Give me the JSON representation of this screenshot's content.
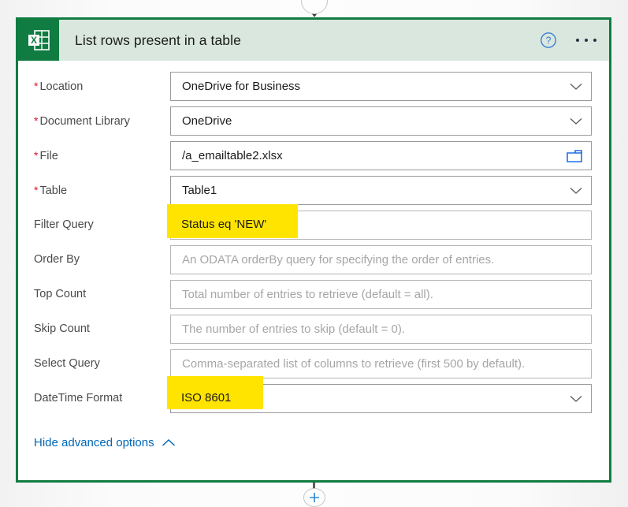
{
  "connector": {
    "top_arrow_icon": "arrow-down-icon",
    "bottom_add_icon": "plus-icon"
  },
  "card": {
    "app_icon": "excel-icon",
    "title": "List rows present in a table",
    "help_icon": "help-circle-icon",
    "more_icon": "more-horizontal-icon",
    "accent_color": "#107c41",
    "header_color": "#d9e7de"
  },
  "fields": [
    {
      "label": "Location",
      "required": true,
      "value": "OneDrive for Business",
      "placeholder": "",
      "control": "dropdown",
      "trailing_icon": "chevron-down-icon",
      "highlighted": false
    },
    {
      "label": "Document Library",
      "required": true,
      "value": "OneDrive",
      "placeholder": "",
      "control": "dropdown",
      "trailing_icon": "chevron-down-icon",
      "highlighted": false
    },
    {
      "label": "File",
      "required": true,
      "value": "/a_emailtable2.xlsx",
      "placeholder": "",
      "control": "file-picker",
      "trailing_icon": "folder-icon",
      "highlighted": false
    },
    {
      "label": "Table",
      "required": true,
      "value": "Table1",
      "placeholder": "",
      "control": "dropdown",
      "trailing_icon": "chevron-down-icon",
      "highlighted": false
    },
    {
      "label": "Filter Query",
      "required": false,
      "value": "Status eq 'NEW'",
      "placeholder": "",
      "control": "text",
      "trailing_icon": "",
      "highlighted": true
    },
    {
      "label": "Order By",
      "required": false,
      "value": "",
      "placeholder": "An ODATA orderBy query for specifying the order of entries.",
      "control": "text",
      "trailing_icon": "",
      "highlighted": false
    },
    {
      "label": "Top Count",
      "required": false,
      "value": "",
      "placeholder": "Total number of entries to retrieve (default = all).",
      "control": "text",
      "trailing_icon": "",
      "highlighted": false
    },
    {
      "label": "Skip Count",
      "required": false,
      "value": "",
      "placeholder": "The number of entries to skip (default = 0).",
      "control": "text",
      "trailing_icon": "",
      "highlighted": false
    },
    {
      "label": "Select Query",
      "required": false,
      "value": "",
      "placeholder": "Comma-separated list of columns to retrieve (first 500 by default).",
      "control": "text",
      "trailing_icon": "",
      "highlighted": false
    },
    {
      "label": "DateTime Format",
      "required": false,
      "value": "ISO 8601",
      "placeholder": "",
      "control": "dropdown",
      "trailing_icon": "chevron-down-icon",
      "highlighted": true
    }
  ],
  "advanced": {
    "label": "Hide advanced options",
    "icon": "chevron-up-icon",
    "link_color": "#0067b8"
  },
  "annotation": {
    "highlight_color": "#ffe400"
  }
}
